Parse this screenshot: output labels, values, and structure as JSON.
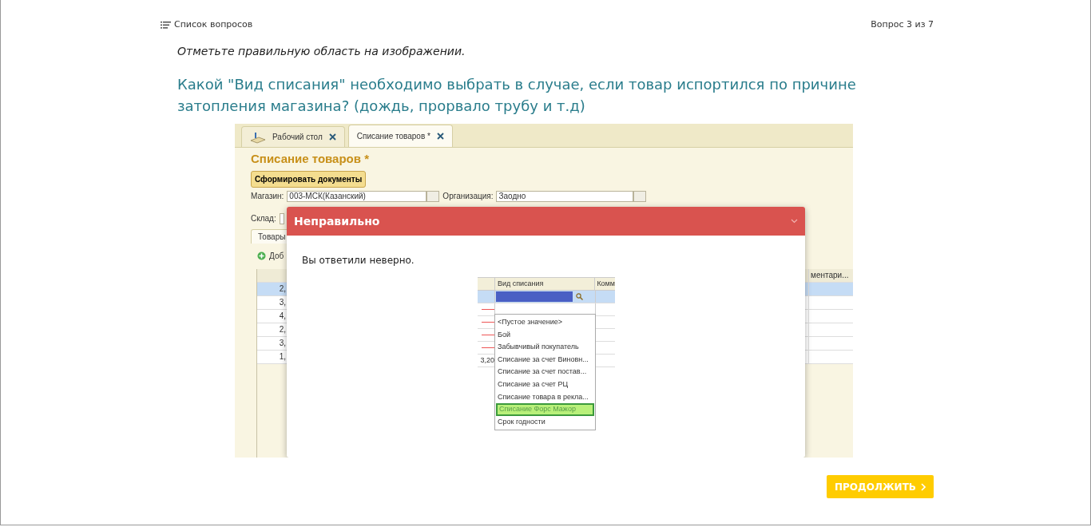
{
  "header": {
    "list_link": "Список вопросов",
    "counter": "Вопрос 3 из 7"
  },
  "instruction": "Отметьте правильную область на изображении.",
  "question": "Какой \"Вид списания\" необходимо выбрать в случае, если товар испортился по причине затопления магазина? (дождь, прорвало трубу и т.д)",
  "screenshot": {
    "tabs": [
      {
        "label": "Рабочий стол",
        "selected": false
      },
      {
        "label": "Списание товаров *",
        "selected": true
      }
    ],
    "title": "Списание товаров *",
    "action_button": "Сформировать документы",
    "fields": [
      {
        "label": "Магазин:",
        "value": "003-МСК(Казанский)"
      },
      {
        "label": "Организация:",
        "value": "Заодно"
      }
    ],
    "warehouse_label": "Склад:",
    "section_tab": "Товары",
    "add_button": "Доб",
    "column_header": "ментари...",
    "rows": [
      {
        "cell": "2,",
        "selected": true
      },
      {
        "cell": "3,",
        "selected": false
      },
      {
        "cell": "4,",
        "selected": false
      },
      {
        "cell": "2,",
        "selected": false
      },
      {
        "cell": "3,",
        "selected": false
      },
      {
        "cell": "1,",
        "selected": false
      }
    ]
  },
  "feedback": {
    "title": "Неправильно",
    "message": "Вы ответили неверно.",
    "answer_image": {
      "columns": [
        "Вид списания",
        "Комм"
      ],
      "cell_value": "3,20",
      "options": [
        {
          "label": "<Пустое значение>",
          "selected": false
        },
        {
          "label": "Бой",
          "selected": false
        },
        {
          "label": "Забывчивый покупатель",
          "selected": false
        },
        {
          "label": "Списание за счет Виновн...",
          "selected": false
        },
        {
          "label": "Списание за счет постав...",
          "selected": false
        },
        {
          "label": "Списание за счет РЦ",
          "selected": false
        },
        {
          "label": "Списание товара в рекла...",
          "selected": false
        },
        {
          "label": "Списание Форс Мажор",
          "selected": true
        },
        {
          "label": "Срок годности",
          "selected": false
        }
      ]
    }
  },
  "continue_button": "ПРОДОЛЖИТЬ"
}
